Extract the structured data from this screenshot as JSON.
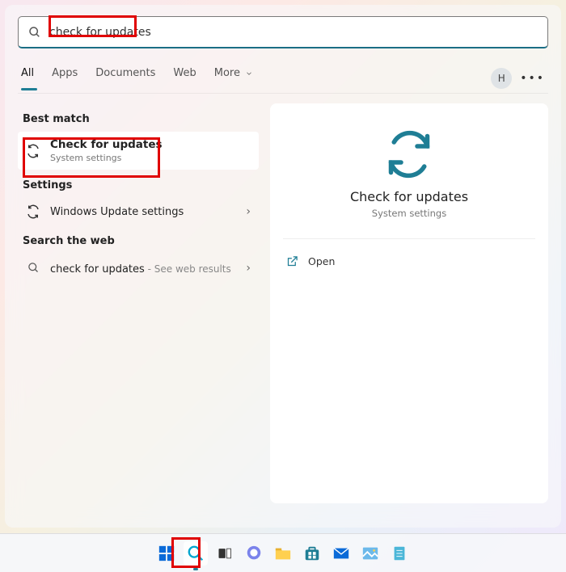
{
  "search": {
    "query": "check for updates"
  },
  "filters": {
    "all": "All",
    "apps": "Apps",
    "documents": "Documents",
    "web": "Web",
    "more": "More"
  },
  "account": {
    "initial": "H"
  },
  "left": {
    "best_match_header": "Best match",
    "best_match": {
      "title": "Check for updates",
      "subtitle": "System settings"
    },
    "settings_header": "Settings",
    "settings_item": "Windows Update settings",
    "web_header": "Search the web",
    "web_item_prefix": "check for updates",
    "web_item_suffix": " - See web results"
  },
  "preview": {
    "title": "Check for updates",
    "subtitle": "System settings",
    "open_label": "Open"
  }
}
